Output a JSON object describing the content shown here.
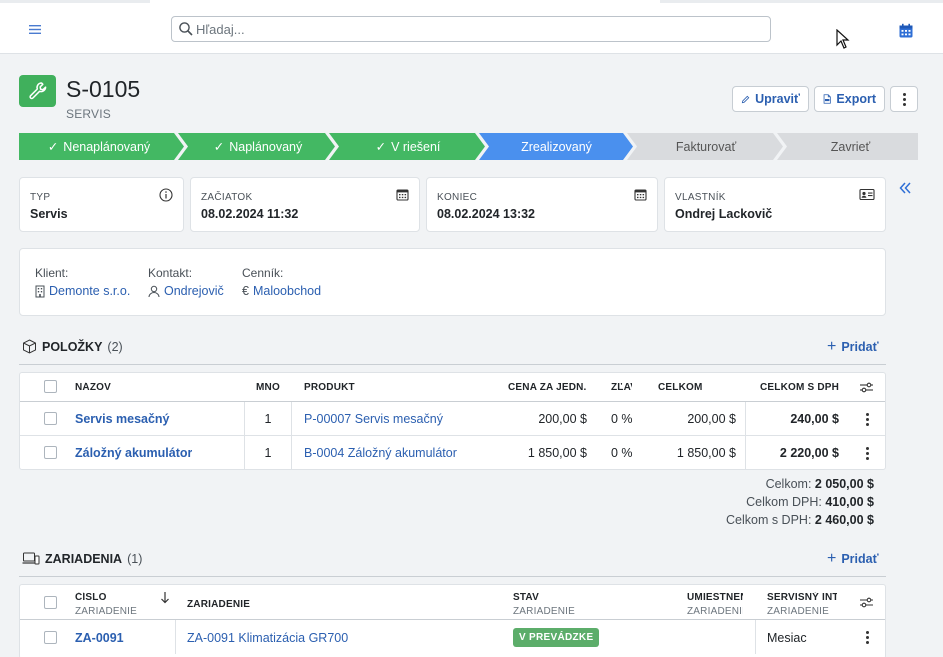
{
  "search": {
    "placeholder": "Hľadaj..."
  },
  "header": {
    "code": "S-0105",
    "type": "SERVIS"
  },
  "actions": {
    "edit": "Upraviť",
    "export": "Export"
  },
  "workflow": [
    {
      "label": "Nenaplánovaný",
      "state": "done"
    },
    {
      "label": "Naplánovaný",
      "state": "done"
    },
    {
      "label": "V riešení",
      "state": "done"
    },
    {
      "label": "Zrealizovaný",
      "state": "current"
    },
    {
      "label": "Fakturovať",
      "state": "todo"
    },
    {
      "label": "Zavrieť",
      "state": "todo"
    }
  ],
  "fields": {
    "typ": {
      "label": "TYP",
      "value": "Servis"
    },
    "start": {
      "label": "ZAČIATOK",
      "value": "08.02.2024 11:32"
    },
    "end": {
      "label": "KONIEC",
      "value": "08.02.2024 13:32"
    },
    "owner": {
      "label": "VLASTNÍK",
      "value": "Ondrej Lackovič"
    }
  },
  "relations": {
    "client": {
      "label": "Klient:",
      "value": "Demonte s.r.o."
    },
    "contact": {
      "label": "Kontakt:",
      "value": "Ondrejovič"
    },
    "pricelist": {
      "label": "Cenník:",
      "value": "Maloobchod"
    }
  },
  "items": {
    "title": "POLOŽKY",
    "count": "(2)",
    "add": "Pridať",
    "columns": {
      "name": "NÁZOV",
      "qty": "MNOŽSTVO",
      "product": "PRODUKT",
      "unit_price": "CENA ZA JEDN.",
      "discount": "ZĽAVA",
      "total": "CELKOM",
      "total_vat": "CELKOM S DPH"
    },
    "rows": [
      {
        "name": "Servis mesačný",
        "qty": "1",
        "product": "P-00007 Servis mesačný",
        "unit_price": "200,00 $",
        "discount": "0 %",
        "total": "200,00 $",
        "total_vat": "240,00 $"
      },
      {
        "name": "Záložný akumulátor",
        "qty": "1",
        "product": "B-0004 Záložný akumulátor",
        "unit_price": "1 850,00 $",
        "discount": "0 %",
        "total": "1 850,00 $",
        "total_vat": "2 220,00 $"
      }
    ],
    "totals": {
      "sum_label": "Celkom:",
      "sum": "2 050,00 $",
      "vat_label": "Celkom DPH:",
      "vat": "410,00 $",
      "sum_vat_label": "Celkom s DPH:",
      "sum_vat": "2 460,00 $"
    }
  },
  "devices": {
    "title": "ZARIADENIA",
    "count": "(1)",
    "add": "Pridať",
    "columns": {
      "number": "ČÍSLO",
      "number_sub": "ZARIADENIE",
      "device": "ZARIADENIE",
      "state": "STAV",
      "state_sub": "ZARIADENIE",
      "location": "UMIESTNENIE",
      "location_sub": "ZARIADENIE",
      "interval": "SERVISNÝ INTERVAL",
      "interval_sub": "ZARIADENIE"
    },
    "rows": [
      {
        "number": "ZA-0091",
        "device": "ZA-0091 Klimatizácia GR700",
        "state": "V PREVÁDZKE",
        "location": "",
        "interval": "Mesiac"
      }
    ]
  }
}
